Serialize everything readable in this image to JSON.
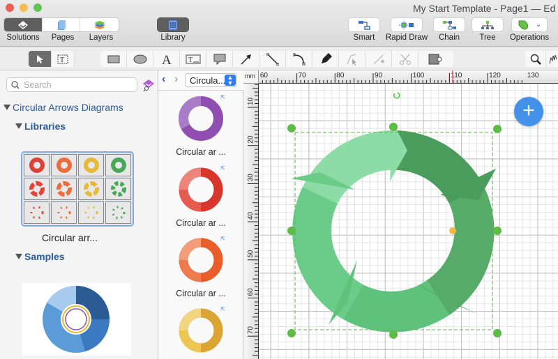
{
  "window": {
    "title": "My Start Template - Page1 — Ed"
  },
  "toolbar": {
    "segments": [
      {
        "label": "Solutions",
        "active": true
      },
      {
        "label": "Pages",
        "active": false
      },
      {
        "label": "Layers",
        "active": false
      }
    ],
    "library_label": "Library",
    "actions": [
      {
        "label": "Smart"
      },
      {
        "label": "Rapid Draw"
      },
      {
        "label": "Chain"
      },
      {
        "label": "Tree"
      },
      {
        "label": "Operations"
      }
    ]
  },
  "drawing_tools": [
    "select-pointer",
    "text-box-select",
    "rectangle",
    "ellipse",
    "text",
    "text-block",
    "callout",
    "arrow-line",
    "line",
    "arc",
    "pen",
    "direct-select",
    "add-point",
    "cut-path",
    "container"
  ],
  "sidebar": {
    "search_placeholder": "Search",
    "solution_title": "Circular Arrows Diagrams",
    "libraries_label": "Libraries",
    "library_caption": "Circular arr...",
    "samples_label": "Samples"
  },
  "library_panel": {
    "selector_value": "Circula...",
    "items": [
      {
        "caption": "Circular ar ...",
        "color": "#8e4fb0"
      },
      {
        "caption": "Circular ar ...",
        "color": "#e04a3f"
      },
      {
        "caption": "Circular ar ...",
        "color": "#ec6d3b"
      },
      {
        "caption": "",
        "color": "#e6b93a"
      }
    ]
  },
  "rulers": {
    "unit": "mm",
    "horizontal_labels": [
      "60",
      "70",
      "80",
      "90",
      "100",
      "110",
      "120",
      "130"
    ],
    "vertical_labels": [
      "10",
      "20",
      "30",
      "40",
      "50",
      "60",
      "70"
    ]
  },
  "canvas": {
    "fab_label": "+",
    "accent": "#4391e9",
    "selection_color": "#5dbb46"
  }
}
